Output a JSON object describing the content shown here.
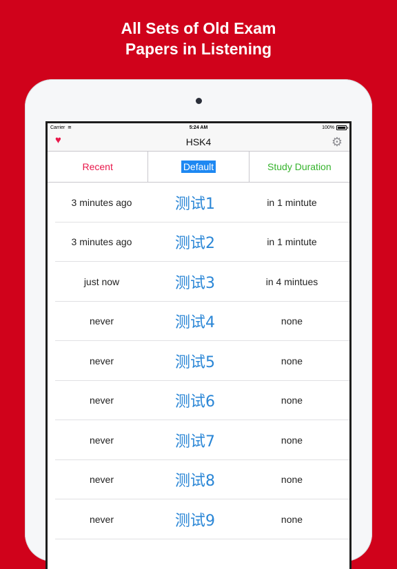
{
  "promo": {
    "line1": "All Sets of Old Exam",
    "line2": "Papers in Listening"
  },
  "status_bar": {
    "carrier": "Carrier",
    "wifi_icon": "wifi-icon",
    "time": "5:24 AM",
    "battery": "100%"
  },
  "nav": {
    "title": "HSK4",
    "left_icon": "heart-icon",
    "right_icon": "gear-icon"
  },
  "segments": {
    "recent": "Recent",
    "default": "Default",
    "duration": "Study Duration",
    "selected": "Default"
  },
  "colors": {
    "background": "#d0021b",
    "recent": "#e8174a",
    "default_selected": "#1e88f2",
    "duration": "#35b32c",
    "test_link": "#2a86d6"
  },
  "rows": [
    {
      "recent": "3 minutes ago",
      "test": "测试1",
      "duration": "in 1 mintute"
    },
    {
      "recent": "3 minutes ago",
      "test": "测试2",
      "duration": "in 1 mintute"
    },
    {
      "recent": "just now",
      "test": "测试3",
      "duration": "in 4 mintues"
    },
    {
      "recent": "never",
      "test": "测试4",
      "duration": "none"
    },
    {
      "recent": "never",
      "test": "测试5",
      "duration": "none"
    },
    {
      "recent": "never",
      "test": "测试6",
      "duration": "none"
    },
    {
      "recent": "never",
      "test": "测试7",
      "duration": "none"
    },
    {
      "recent": "never",
      "test": "测试8",
      "duration": "none"
    },
    {
      "recent": "never",
      "test": "测试9",
      "duration": "none"
    }
  ]
}
